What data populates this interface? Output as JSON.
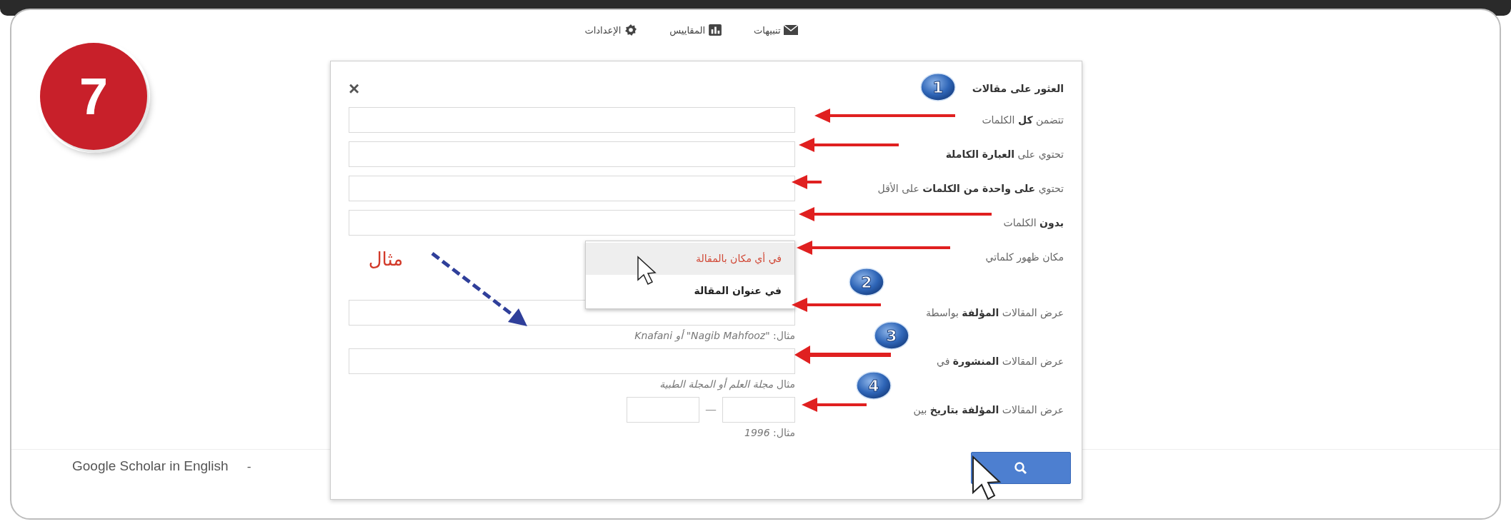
{
  "top_nav": [
    {
      "label": "تنبيهات",
      "kind": "mail"
    },
    {
      "label": "المقاييس",
      "kind": "metrics"
    },
    {
      "label": "الإعدادات",
      "kind": "settings"
    }
  ],
  "step_number": "7",
  "dialog": {
    "close": "×",
    "title": "العثور على مقالات",
    "rows": [
      {
        "kind": "text",
        "label": "تتضمن **كل** الكلمات"
      },
      {
        "kind": "text",
        "label": "تحتوي على **العبارة الكاملة**"
      },
      {
        "kind": "text",
        "label": "تحتوي **على واحدة من الكلمات** على الأقل"
      },
      {
        "kind": "text",
        "label": "**بدون** الكلمات"
      },
      {
        "kind": "dropdown",
        "label": "مكان ظهور كلماتي",
        "options": [
          {
            "label": "في أي مكان بالمقالة",
            "selected": true
          },
          {
            "label": "في عنوان المقالة",
            "selected": false
          }
        ]
      },
      {
        "kind": "text",
        "label": "عرض المقالات **المؤلفة** بواسطة",
        "hint": "مثال: *\"Nagib Mahfooz\" أو Knafani*"
      },
      {
        "kind": "text",
        "label": "عرض المقالات **المنشورة** في",
        "hint": "مثال *مجلة العلم أو المجلة الطبية*"
      },
      {
        "kind": "range",
        "label": "عرض المقالات **المؤلفة بتاريخ** بين",
        "separator": "—",
        "hint": "مثال: *1996*"
      }
    ]
  },
  "annotations": {
    "badges": [
      "1",
      "2",
      "3",
      "4"
    ],
    "example_note": "مثال"
  },
  "footer": {
    "language_link": "Google Scholar in English",
    "cut_text": "-"
  }
}
